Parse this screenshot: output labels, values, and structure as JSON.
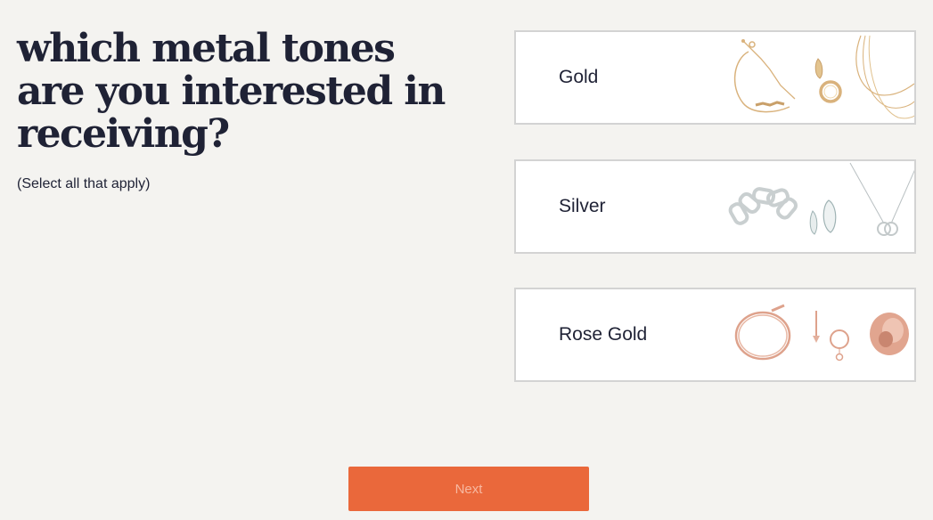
{
  "question": {
    "title": "which metal tones are you interested in receiving?",
    "hint": "(Select all that apply)"
  },
  "options": [
    {
      "label": "Gold",
      "color": "#d9b27c",
      "icon": "gold-jewelry-image"
    },
    {
      "label": "Silver",
      "color": "#c7cccd",
      "icon": "silver-jewelry-image"
    },
    {
      "label": "Rose Gold",
      "color": "#dea28c",
      "icon": "rose-gold-jewelry-image"
    }
  ],
  "actions": {
    "next_label": "Next",
    "next_color": "#ea683b"
  }
}
